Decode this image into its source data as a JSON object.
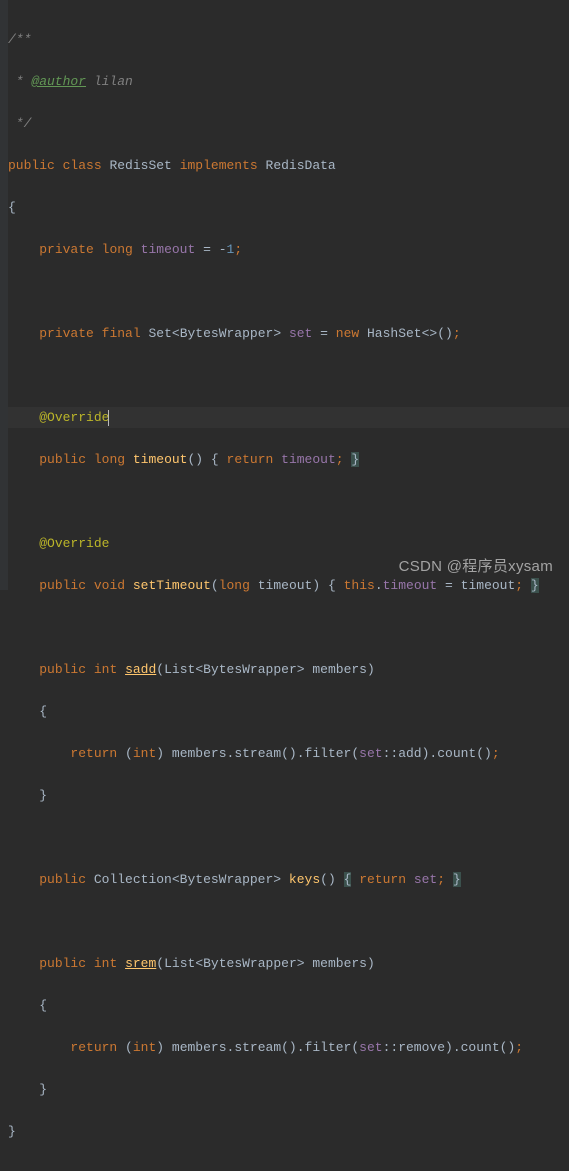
{
  "doc": {
    "open": "/**",
    "author_tag": "@author",
    "author_name": "lilan",
    "close": " */"
  },
  "kw": {
    "public": "public",
    "class": "class",
    "implements": "implements",
    "private": "private",
    "long": "long",
    "final": "final",
    "new": "new",
    "return": "return",
    "void": "void",
    "int": "int",
    "this": "this"
  },
  "types": {
    "RedisSet": "RedisSet",
    "RedisData": "RedisData",
    "Set": "Set",
    "BytesWrapper": "BytesWrapper",
    "HashSet": "HashSet",
    "List": "List",
    "Collection": "Collection"
  },
  "fields": {
    "timeout": "timeout",
    "set": "set",
    "minus1": "1"
  },
  "ann": {
    "override": "@Override"
  },
  "methods": {
    "timeout": "timeout",
    "setTimeout": "setTimeout",
    "sadd": "sadd",
    "stream": "stream",
    "filter": "filter",
    "add": "add",
    "count": "count",
    "keys": "keys",
    "srem": "srem",
    "remove": "remove"
  },
  "ident": {
    "members": "members",
    "timeout_param": "timeout"
  },
  "watermark": "CSDN @程序员xysam"
}
